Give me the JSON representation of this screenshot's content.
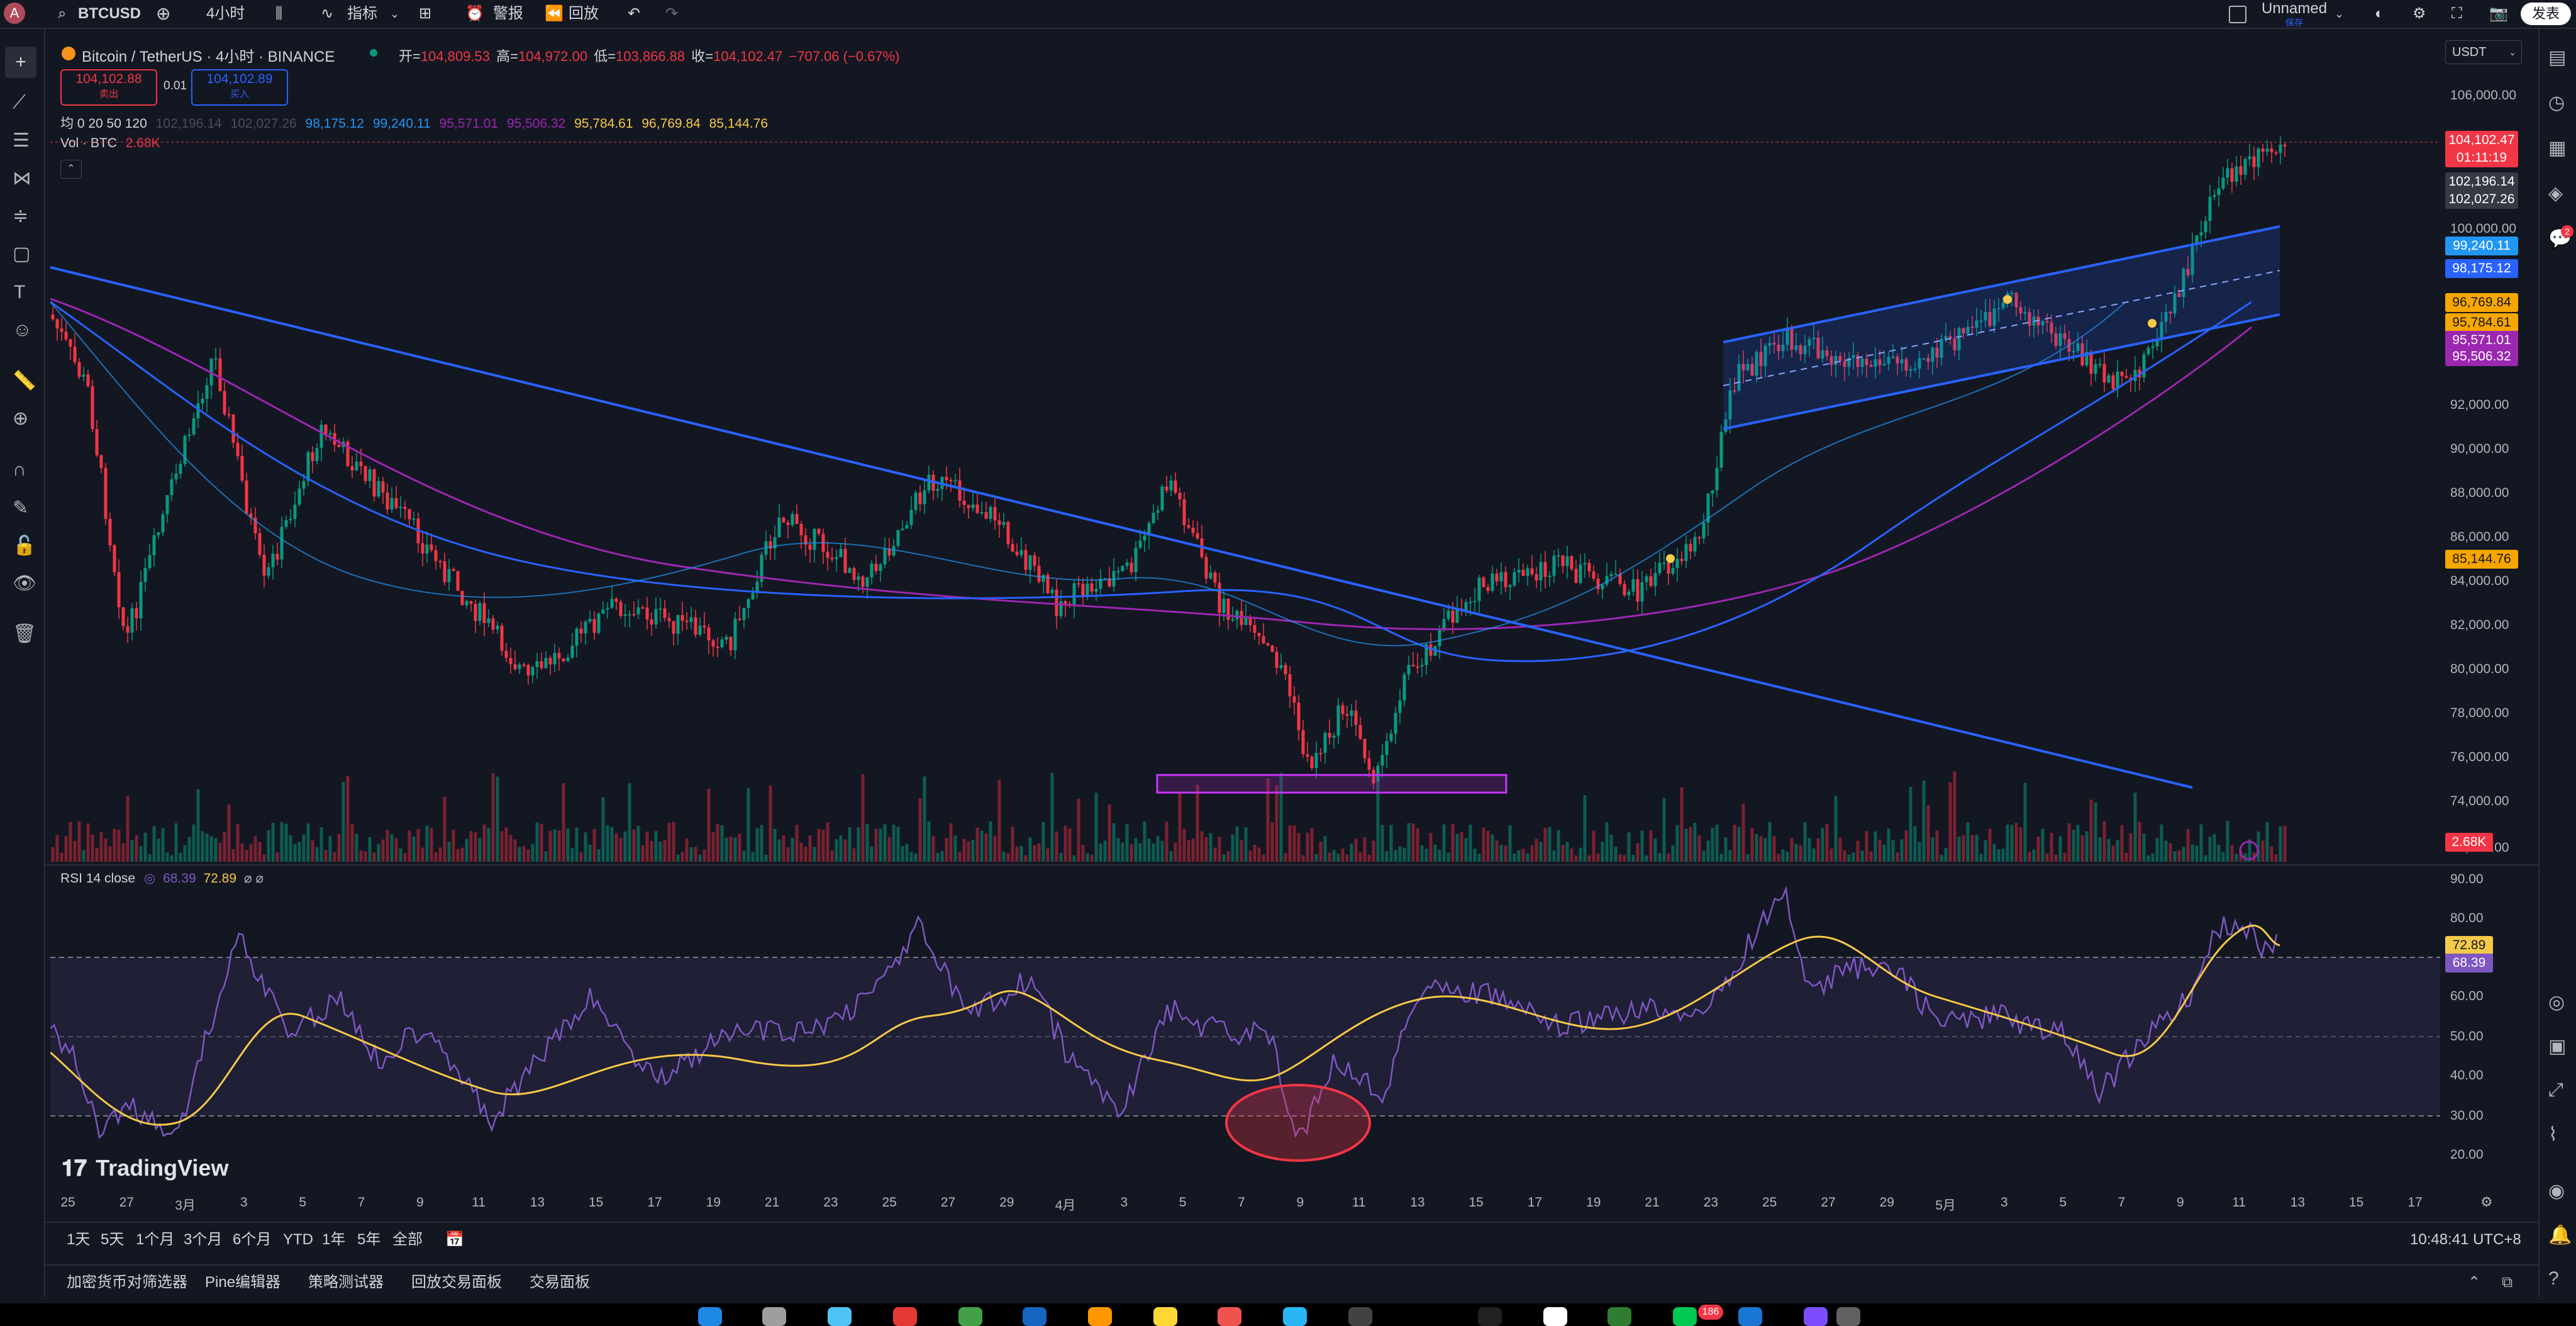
{
  "topbar": {
    "user_initial": "A",
    "symbol": "BTCUSD",
    "interval": "4小时",
    "indicators_label": "指标",
    "alert_label": "警报",
    "replay_label": "回放",
    "layout_name": "Unnamed",
    "layout_status": "保存",
    "publish_label": "发表"
  },
  "legend": {
    "title": "Bitcoin / TetherUS · 4小时 · BINANCE",
    "open_label": "开=",
    "open": "104,809.53",
    "high_label": "高=",
    "high": "104,972.00",
    "low_label": "低=",
    "low": "103,866.88",
    "close_label": "收=",
    "close": "104,102.47",
    "change": "−707.06 (−0.67%)",
    "sell_price": "104,102.88",
    "sell_label": "卖出",
    "spread": "0.01",
    "buy_price": "104,102.89",
    "buy_label": "买入",
    "ma_label": "均 0 20 50 120",
    "ma_values": [
      "102,196.14",
      "102,027.26",
      "98,175.12",
      "99,240.11",
      "95,571.01",
      "95,506.32",
      "95,784.61",
      "96,769.84",
      "85,144.76"
    ],
    "vol_label": "Vol · BTC",
    "vol_value": "2.68K",
    "rsi_label": "RSI 14 close",
    "rsi_value": "68.39",
    "rsi_ma_value": "72.89",
    "currency": "USDT"
  },
  "price_axis": {
    "ticks": [
      "106,000.00",
      "100,000.00",
      "92,000.00",
      "90,000.00",
      "88,000.00",
      "86,000.00",
      "84,000.00",
      "82,000.00",
      "80,000.00",
      "78,000.00",
      "76,000.00",
      "74,000.00",
      "72,000.00"
    ],
    "tags": [
      {
        "text": "104,102.47",
        "color": "#f23645"
      },
      {
        "text": "01:11:19",
        "color": "#f23645"
      },
      {
        "text": "102,196.14",
        "color": "#363a45"
      },
      {
        "text": "102,027.26",
        "color": "#363a45"
      },
      {
        "text": "99,240.11",
        "color": "#2196f3"
      },
      {
        "text": "98,175.12",
        "color": "#2962ff"
      },
      {
        "text": "96,769.84",
        "color": "#f7a600"
      },
      {
        "text": "95,784.61",
        "color": "#f7a600"
      },
      {
        "text": "95,571.01",
        "color": "#9c27b0"
      },
      {
        "text": "95,506.32",
        "color": "#9c27b0"
      },
      {
        "text": "85,144.76",
        "color": "#f7a600"
      },
      {
        "text": "2.68K",
        "color": "#f23645"
      }
    ]
  },
  "rsi_axis": {
    "ticks": [
      "90.00",
      "80.00",
      "60.00",
      "50.00",
      "40.00",
      "30.00",
      "20.00"
    ],
    "tags": [
      {
        "text": "72.89",
        "color": "#f7c948"
      },
      {
        "text": "68.39",
        "color": "#7e57c2"
      }
    ]
  },
  "time_axis": [
    "25",
    "27",
    "3月",
    "3",
    "5",
    "7",
    "9",
    "11",
    "13",
    "15",
    "17",
    "19",
    "21",
    "23",
    "25",
    "27",
    "29",
    "4月",
    "3",
    "5",
    "7",
    "9",
    "11",
    "13",
    "15",
    "17",
    "19",
    "21",
    "23",
    "25",
    "27",
    "29",
    "5月",
    "3",
    "5",
    "7",
    "9",
    "11",
    "13",
    "15",
    "17"
  ],
  "bottombar": {
    "ranges": [
      "1天",
      "5天",
      "1个月",
      "3个月",
      "6个月",
      "YTD",
      "1年",
      "5年",
      "全部"
    ],
    "clock": "10:48:41 UTC+8"
  },
  "panels": [
    "加密货币对筛选器",
    "Pine编辑器",
    "策略测试器",
    "回放交易面板",
    "交易面板"
  ],
  "watermark": "TradingView",
  "notification_count": "2",
  "dock_badge": "186"
}
